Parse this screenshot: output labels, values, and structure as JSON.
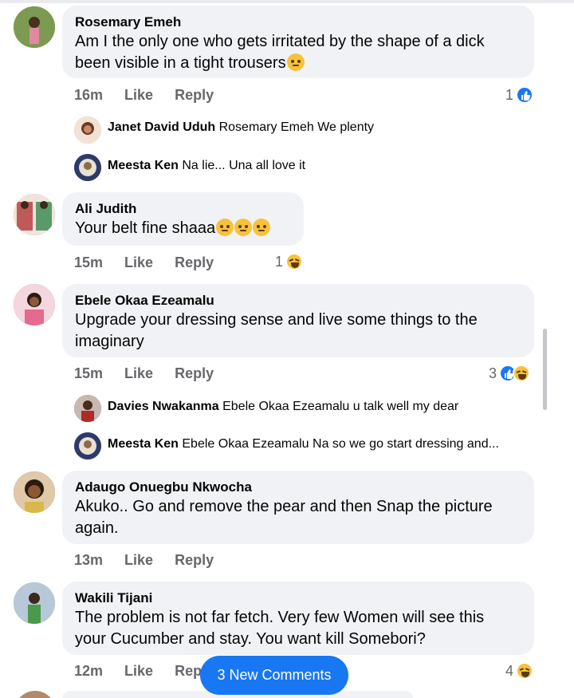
{
  "comments": [
    {
      "author": "Rosemary Emeh",
      "text_lines": [
        "Am I the only one who gets irritated by the shape of a dick",
        "been visible in a tight trousers"
      ],
      "time": "16m",
      "like": "Like",
      "reply": "Reply",
      "reaction_count": "1",
      "reaction_icons": [
        "like-icon"
      ],
      "avatar_color": "#6b8a4a"
    },
    {
      "author": "Ali Judith",
      "text": "Your belt fine shaaa",
      "time": "15m",
      "like": "Like",
      "reply": "Reply",
      "reaction_count": "1",
      "reaction_icons": [
        "haha-icon"
      ],
      "avatar_color": "#c0685c"
    },
    {
      "author": "Ebele Okaa Ezeamalu",
      "text_lines": [
        "Upgrade your dressing sense and live some things to the",
        "imaginary"
      ],
      "time": "15m",
      "like": "Like",
      "reply": "Reply",
      "reaction_count": "3",
      "reaction_icons": [
        "like-icon",
        "haha-icon"
      ],
      "avatar_color": "#c9607a"
    },
    {
      "author": "Adaugo Onuegbu Nkwocha",
      "text_lines": [
        "Akuko.. Go and remove the pear and then Snap the picture",
        "again."
      ],
      "time": "13m",
      "like": "Like",
      "reply": "Reply",
      "avatar_color": "#7a4a2a"
    },
    {
      "author": "Wakili Tijani",
      "text_lines": [
        "The problem is not far fetch. Very few Women will see this",
        "your Cucumber and stay. You want kill Somebori?"
      ],
      "time": "12m",
      "like": "Like",
      "reply": "Rep",
      "reaction_count": "4",
      "reaction_icons": [
        "haha-icon"
      ],
      "avatar_color": "#8a9a6a"
    }
  ],
  "replies": [
    {
      "name": "Janet David Uduh",
      "text": "Rosemary Emeh We plenty",
      "avatar_color": "#d09070"
    },
    {
      "name": "Meesta Ken",
      "text": "Na lie... Una all love it",
      "avatar_color": "#5a6a9a"
    },
    {
      "name": "Davies Nwakanma",
      "text": "Ebele Okaa Ezeamalu u talk well my dear",
      "avatar_color": "#8a3a3a"
    },
    {
      "name": "Meesta Ken",
      "text": "Ebele Okaa Ezeamalu Na so we go start dressing and...",
      "avatar_color": "#5a6a9a"
    }
  ],
  "new_comments_label": "3 New Comments",
  "colors": {
    "accent": "#1877f2",
    "bubble": "#f0f2f5",
    "muted": "#65676b"
  }
}
